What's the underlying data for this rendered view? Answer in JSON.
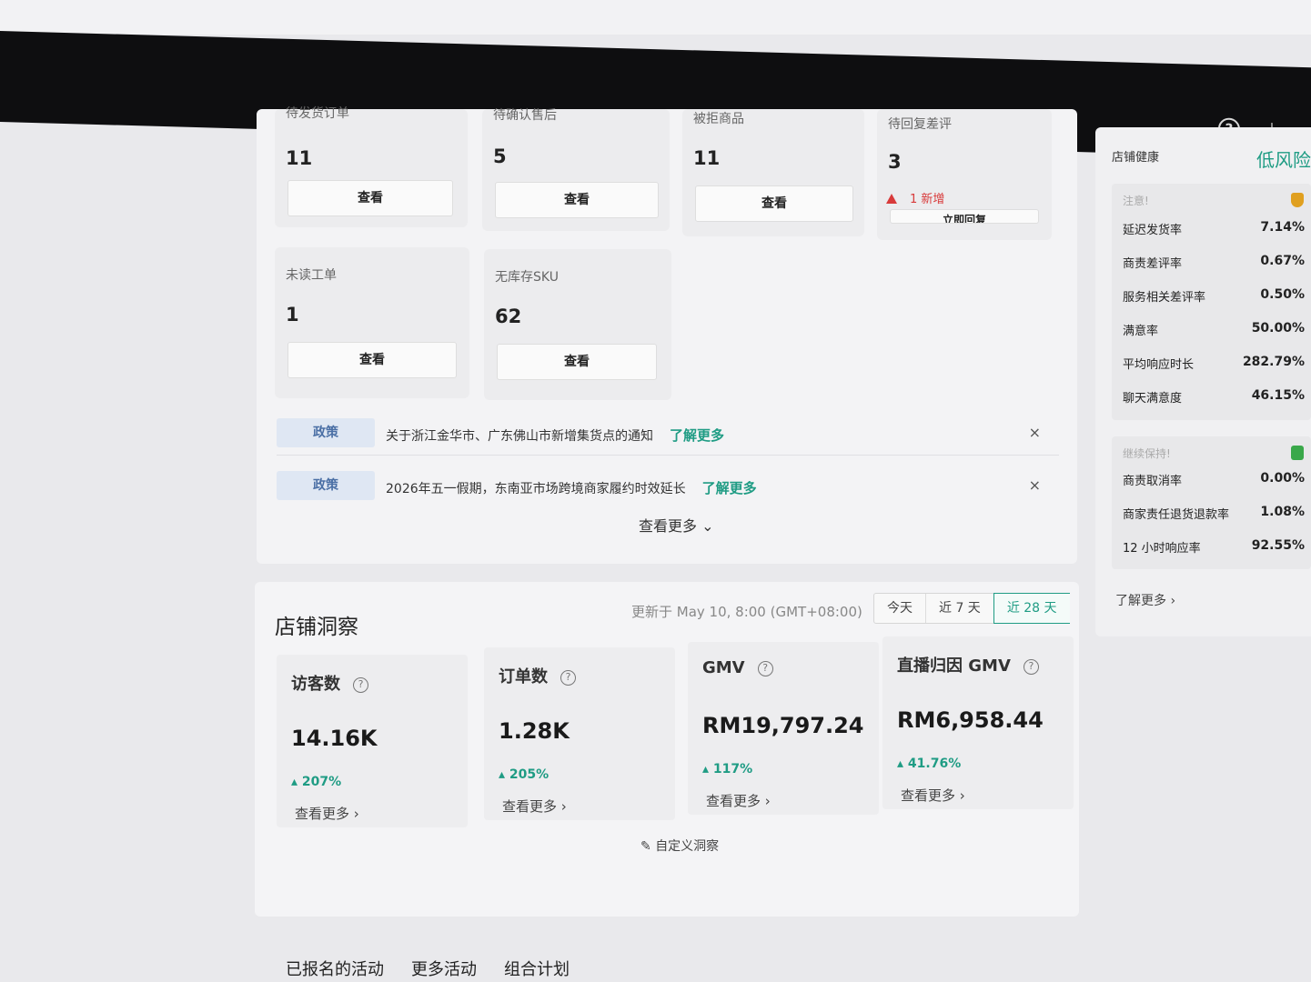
{
  "header": {},
  "todo_cards": [
    {
      "label": "待发货订单",
      "count": "11",
      "action": "查看"
    },
    {
      "label": "待确认售后",
      "count": "5",
      "action": "查看"
    },
    {
      "label": "被拒商品",
      "count": "11",
      "action": "查看"
    },
    {
      "label": "待回复差评",
      "count": "3",
      "alert": "1 新增",
      "action": "立即回复"
    },
    {
      "label": "未读工单",
      "count": "1",
      "action": "查看"
    },
    {
      "label": "无库存SKU",
      "count": "62",
      "action": "查看"
    }
  ],
  "notices": [
    {
      "tag": "政策",
      "text": "关于浙江金华市、广东佛山市新增集货点的通知",
      "link": "了解更多"
    },
    {
      "tag": "政策",
      "text": "2026年五一假期，东南亚市场跨境商家履约时效延长",
      "link": "了解更多"
    }
  ],
  "notices_view_more": "查看更多",
  "insights": {
    "title": "店铺洞察",
    "updated": "更新于 May 10, 8:00 (GMT+08:00)",
    "ranges": [
      "今天",
      "近 7 天",
      "近 28 天"
    ],
    "active_range": "近 28 天",
    "metrics": [
      {
        "label": "访客数",
        "value": "14.16K",
        "delta": "207%",
        "more": "查看更多"
      },
      {
        "label": "订单数",
        "value": "1.28K",
        "delta": "205%",
        "more": "查看更多"
      },
      {
        "label": "GMV",
        "value": "RM19,797.24",
        "delta": "117%",
        "more": "查看更多"
      },
      {
        "label": "直播归因 GMV",
        "value": "RM6,958.44",
        "delta": "41.76%",
        "more": "查看更多"
      }
    ],
    "custom": "自定义洞察"
  },
  "bottom_tabs": [
    "已报名的活动",
    "更多活动",
    "组合计划"
  ],
  "shop_health": {
    "title": "店铺健康",
    "risk": "低风险",
    "attention_head": "注意!",
    "attention": [
      {
        "k": "延迟发货率",
        "v": "7.14%"
      },
      {
        "k": "商责差评率",
        "v": "0.67%"
      },
      {
        "k": "服务相关差评率",
        "v": "0.50%"
      },
      {
        "k": "满意率",
        "v": "50.00%"
      },
      {
        "k": "平均响应时长",
        "v": "282.79%"
      },
      {
        "k": "聊天满意度",
        "v": "46.15%"
      }
    ],
    "keep_head": "继续保持!",
    "keep": [
      {
        "k": "商责取消率",
        "v": "0.00%"
      },
      {
        "k": "商家责任退货退款率",
        "v": "1.08%"
      },
      {
        "k": "12 小时响应率",
        "v": "92.55%"
      }
    ],
    "more": "了解更多"
  },
  "colors": {
    "accent": "#1f9c84",
    "alert": "#d83a3a",
    "topbar": "#0e0e10",
    "warn_icon": "#e0a020",
    "good_icon": "#3aa84a"
  }
}
